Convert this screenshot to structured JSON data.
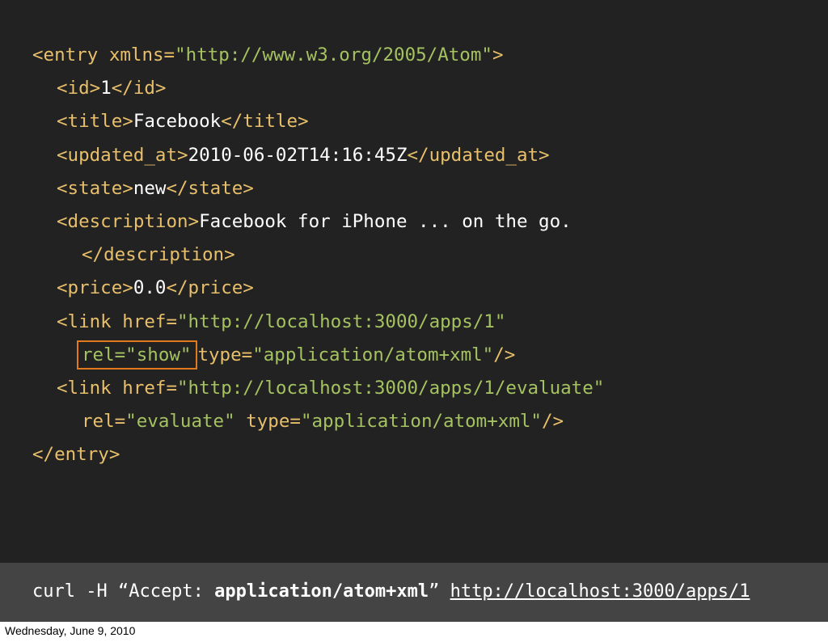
{
  "code": {
    "l1_open": "<entry ",
    "l1_attr": "xmlns=",
    "l1_val": "\"http://www.w3.org/2005/Atom\"",
    "l1_close": ">",
    "l2_open": "<id>",
    "l2_text": "1",
    "l2_close": "</id>",
    "l3_open": "<title>",
    "l3_text": "Facebook",
    "l3_close": "</title>",
    "l4_open": "<updated_at>",
    "l4_text": "2010-06-02T14:16:45Z",
    "l4_close": "</updated_at>",
    "l5_open": "<state>",
    "l5_text": "new",
    "l5_close": "</state>",
    "l6_open": "<description>",
    "l6_text": "Facebook for iPhone ... on the go.",
    "l7_close": "</description>",
    "l8_open": "<price>",
    "l8_text": "0.0",
    "l8_close": "</price>",
    "l9_open": "<link ",
    "l9_attr": "href=",
    "l9_val": "\"http://localhost:3000/apps/1\"",
    "l10_rel": "rel=\"show\"",
    "l10_type_attr": "type=",
    "l10_type_val": "\"application/atom+xml\"",
    "l10_end": "/>",
    "l11_open": "<link ",
    "l11_attr": "href=",
    "l11_val": "\"http://localhost:3000/apps/1/evaluate\"",
    "l12_rel_attr": "rel=",
    "l12_rel_val": "\"evaluate\"",
    "l12_type_attr": "type=",
    "l12_type_val": "\"application/atom+xml\"",
    "l12_end": "/>",
    "l13_close": "</entry>"
  },
  "command": {
    "prefix": "curl -H “Accept: ",
    "accept_value": "application/atom+xml",
    "quote_end": "” ",
    "url": "http://localhost:3000/apps/1"
  },
  "footer": {
    "date": "Wednesday, June 9, 2010"
  },
  "colors": {
    "background": "#222222",
    "tag": "#e8bf6a",
    "string": "#a5c261",
    "highlight_border": "#e07a1c",
    "command_bar": "#444444"
  }
}
